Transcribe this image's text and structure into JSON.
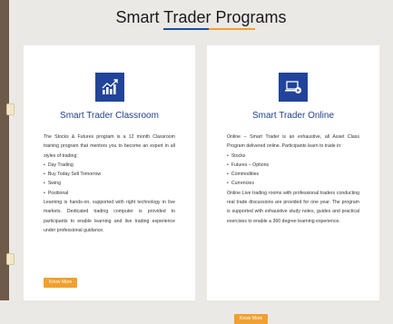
{
  "header": {
    "title": "Smart Trader Programs"
  },
  "colors": {
    "accent_blue": "#21449a",
    "accent_orange": "#f0a030"
  },
  "cards": [
    {
      "title": "Smart Trader Classroom",
      "icon": "growth-chart-icon",
      "intro": "The Stocks & Futures program is a 12 month Classroom training program that mentors you to become an expert in all styles of trading:",
      "items": [
        "Day Trading",
        "Buy Today Sell Tomorrow",
        "Swing",
        "Positional"
      ],
      "outro": "Learning is hands-on, supported with right technology in live markets. Dedicated trading computer is provided to participants to enable learning and live trading experience under professional guidance.",
      "button": "Know More"
    },
    {
      "title": "Smart Trader Online",
      "icon": "online-video-laptop-icon",
      "intro": "Online – Smart Trader is an exhaustive, all Asset Class Program delivered online. Participants learn to trade in:",
      "items": [
        "Stocks",
        "Futures – Options",
        "Commodities",
        "Currencies"
      ],
      "outro": "Online Live trading rooms with professional traders conducting real trade discussions are provided for one year. The program is supported with exhaustive study notes, guides and practical exercises to enable a 360 degree learning experience.",
      "button": "Know More"
    }
  ]
}
